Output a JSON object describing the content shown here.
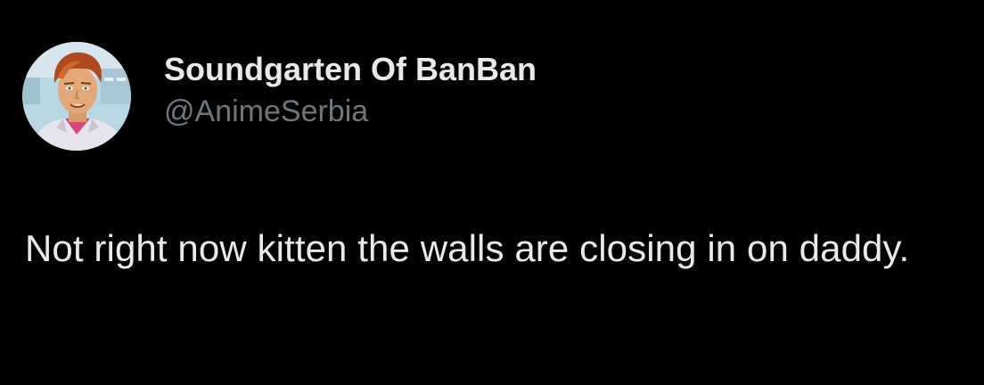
{
  "tweet": {
    "author": {
      "display_name": "Soundgarten Of BanBan",
      "handle": "@AnimeSerbia",
      "avatar_icon": "profile-avatar"
    },
    "text": "Not right now kitten the walls are closing in on daddy."
  },
  "colors": {
    "background": "#000000",
    "primary_text": "#e7e9ea",
    "secondary_text": "#71767b"
  }
}
